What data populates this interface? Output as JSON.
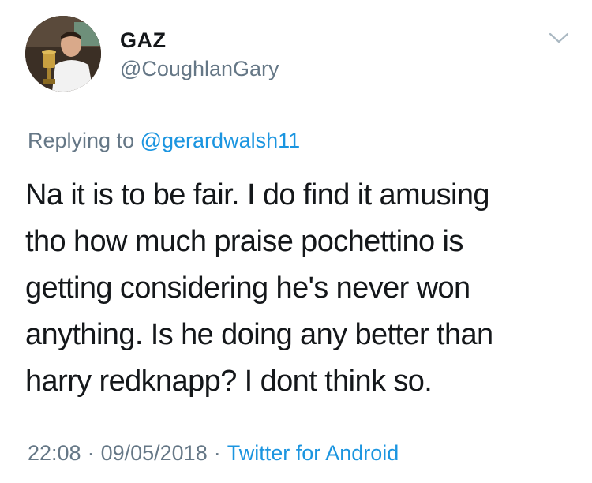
{
  "user": {
    "display_name": "GAZ",
    "handle": "@CoughlanGary",
    "avatar_icon": "profile-photo-with-trophy"
  },
  "menu_icon": "chevron-down-icon",
  "reply": {
    "prefix": "Replying to",
    "target": "@gerardwalsh11"
  },
  "tweet": {
    "lines": [
      "Na it is to be fair. I do find it amusing",
      "tho how much praise pochettino is",
      "getting considering he's never won",
      "anything. Is he doing any better than",
      "harry redknapp? I dont think so."
    ]
  },
  "meta": {
    "time": "22:08",
    "date": "09/05/2018",
    "separator": "·",
    "source": "Twitter for Android"
  },
  "colors": {
    "text": "#14171a",
    "secondary": "#657786",
    "link": "#1b95e0"
  }
}
